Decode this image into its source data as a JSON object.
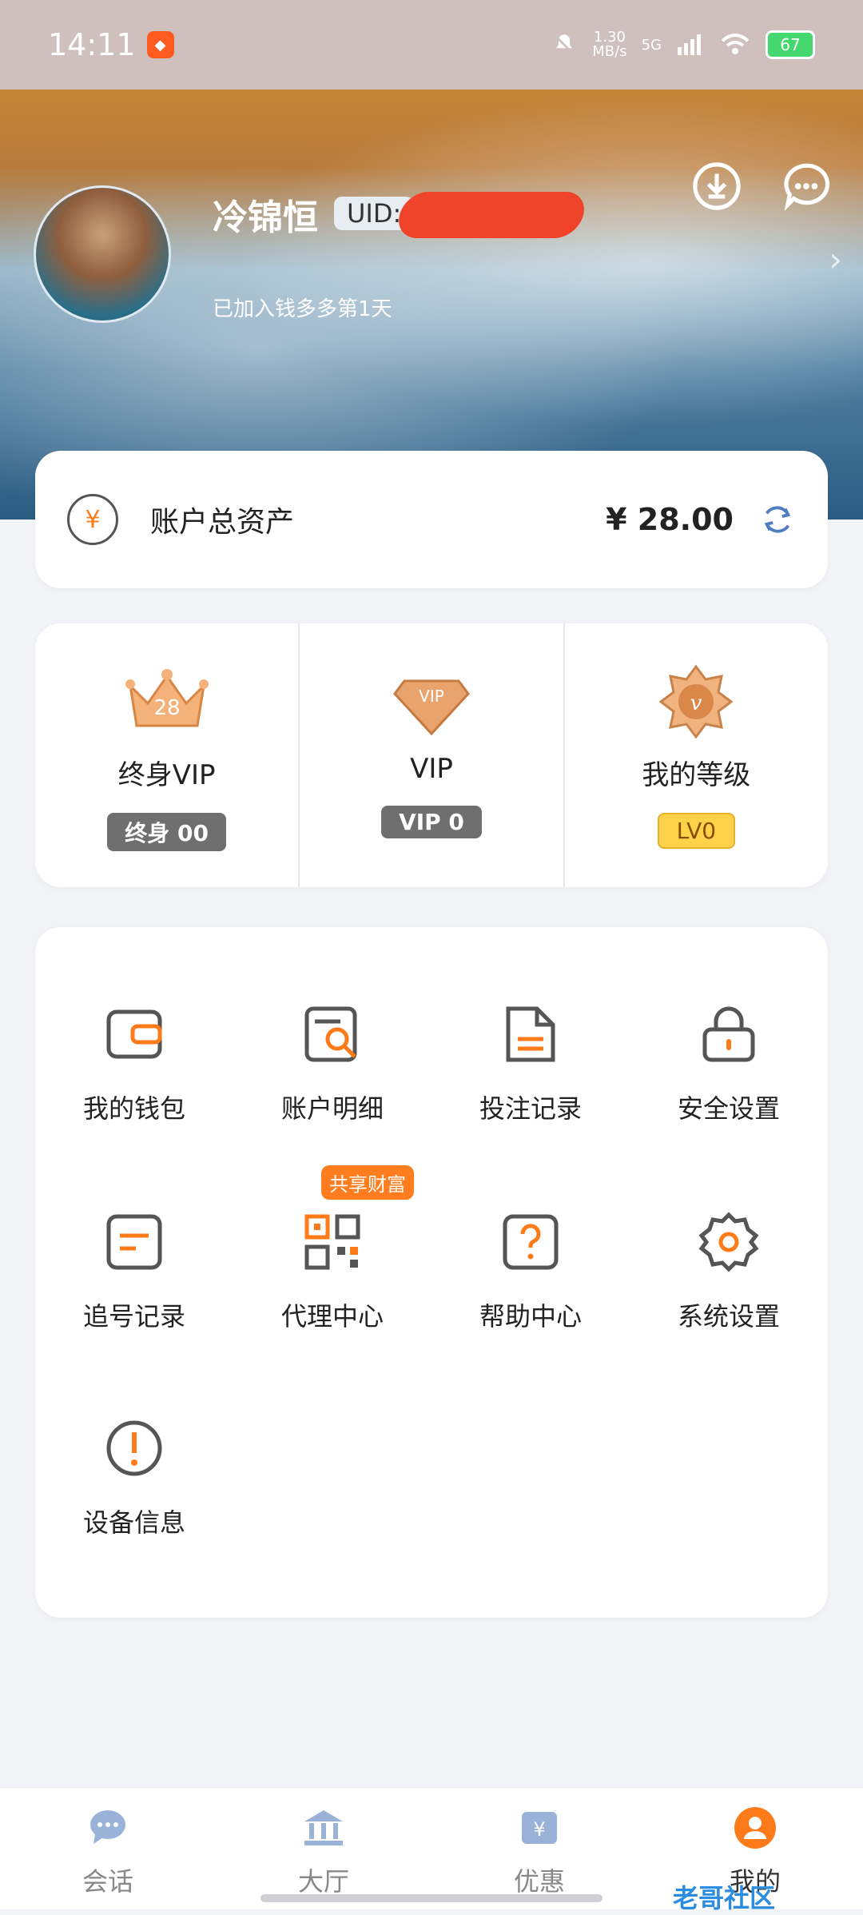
{
  "status": {
    "time": "14:11",
    "network_speed": "1.30\nMB/s",
    "network_type": "5G",
    "battery": "67",
    "icons": [
      "app-badge-icon",
      "mute-icon",
      "signal-icon",
      "wifi-icon",
      "battery-icon"
    ]
  },
  "header": {
    "username": "冷锦恒",
    "uid_label": "UID:",
    "joined_text": "已加入钱多多第1天",
    "actions": [
      "download-icon",
      "chat-icon"
    ]
  },
  "assets": {
    "label": "账户总资产",
    "amount": "¥ 28.00"
  },
  "vip": {
    "items": [
      {
        "title": "终身VIP",
        "badge": "终身 00",
        "emblem_text": "28"
      },
      {
        "title": "VIP",
        "badge": "VIP 0",
        "emblem_text": "VIP"
      },
      {
        "title": "我的等级",
        "badge": "LV0",
        "emblem_text": "v"
      }
    ]
  },
  "menu": {
    "items": [
      {
        "label": "我的钱包",
        "icon": "wallet-icon"
      },
      {
        "label": "账户明细",
        "icon": "ledger-search-icon"
      },
      {
        "label": "投注记录",
        "icon": "document-icon"
      },
      {
        "label": "安全设置",
        "icon": "lock-icon"
      },
      {
        "label": "追号记录",
        "icon": "list-box-icon"
      },
      {
        "label": "代理中心",
        "icon": "qr-code-icon",
        "tag": "共享财富"
      },
      {
        "label": "帮助中心",
        "icon": "help-icon"
      },
      {
        "label": "系统设置",
        "icon": "gear-icon"
      },
      {
        "label": "设备信息",
        "icon": "info-alert-icon"
      }
    ]
  },
  "tabs": [
    {
      "label": "会话",
      "icon": "chat-bubble-icon"
    },
    {
      "label": "大厅",
      "icon": "bank-icon"
    },
    {
      "label": "优惠",
      "icon": "coupon-icon"
    },
    {
      "label": "我的",
      "icon": "user-icon"
    }
  ],
  "watermark": "老哥社区",
  "colors": {
    "accent": "#ff7a18",
    "status_bg": "#cfc0bd",
    "bg": "#f2f3f7"
  }
}
